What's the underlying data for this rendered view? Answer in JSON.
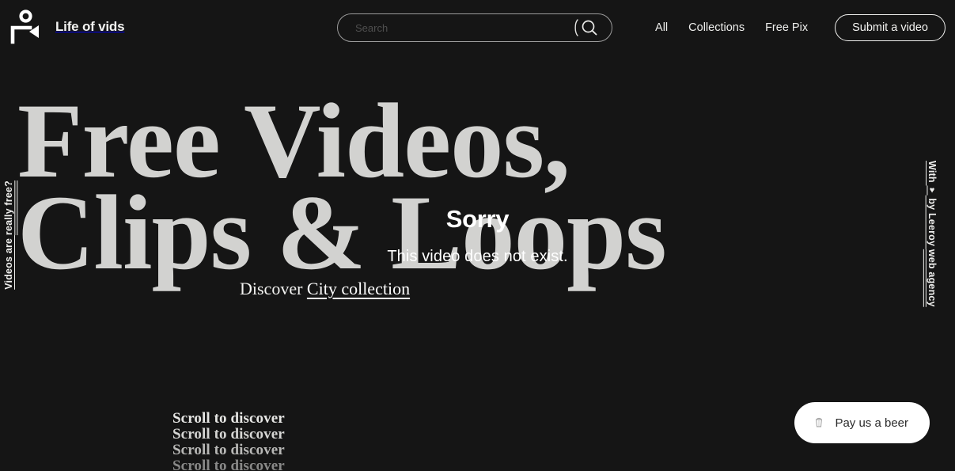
{
  "site": {
    "background_color": "#151515",
    "heading_color": "#d2d2d0",
    "accent_color": "#ffffff"
  },
  "header": {
    "brand_name": "Life of vids",
    "logo_icon": "person-video-logo-icon",
    "search": {
      "placeholder": "Search",
      "value": "",
      "icon": "search-icon"
    },
    "nav_links": [
      {
        "label": "All"
      },
      {
        "label": "Collections"
      },
      {
        "label": "Free Pix"
      }
    ],
    "submit_button": "Submit a video"
  },
  "hero": {
    "title_line_1": "Free Videos,",
    "title_line_2": "Clips & Loops",
    "discover_prefix": "Discover",
    "discover_link": "City collection"
  },
  "video_error": {
    "title": "Sorry",
    "message": "This video does not exist."
  },
  "side_labels": {
    "left_prefix": "Videos are ",
    "left_underlined": "really free?",
    "right_prefix": "With ",
    "right_heart": "♥",
    "right_middle": " by Leeroy ",
    "right_underlined": "web agency"
  },
  "scroll_prompt": {
    "lines": [
      "Scroll to discover",
      "Scroll to discover",
      "Scroll to discover",
      "Scroll to discover"
    ]
  },
  "donate": {
    "label": "Pay us a beer",
    "icon": "beer-glass-icon"
  }
}
